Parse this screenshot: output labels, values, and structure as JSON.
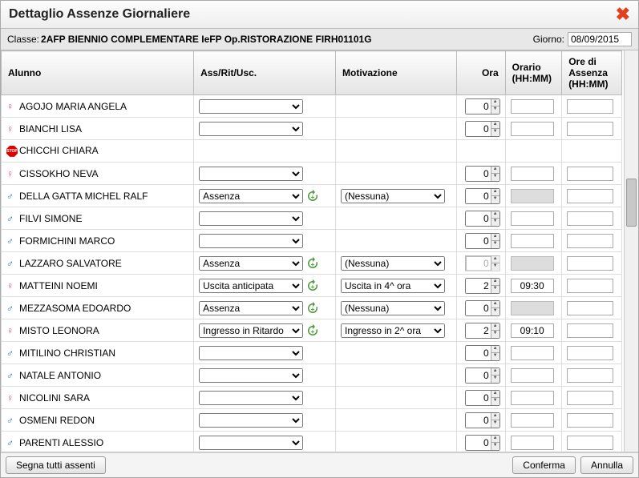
{
  "title": "Dettaglio Assenze Giornaliere",
  "class_label": "Classe:",
  "class_value": "2AFP BIENNIO COMPLEMENTARE IeFP Op.RISTORAZIONE FIRH01101G",
  "day_label": "Giorno:",
  "day_value": "08/09/2015",
  "columns": {
    "alunno": "Alunno",
    "ass": "Ass/Rit/Usc.",
    "motiv": "Motivazione",
    "ora": "Ora",
    "orario": "Orario (HH:MM)",
    "ore": "Ore di Assenza (HH:MM)"
  },
  "type_options": [
    "",
    "Assenza",
    "Ingresso in Ritardo",
    "Uscita anticipata"
  ],
  "motiv_options": [
    "",
    "(Nessuna)",
    "Ingresso in 2^ ora",
    "Uscita in 4^ ora"
  ],
  "rows": [
    {
      "gender": "F",
      "name": "AGOJO MARIA ANGELA",
      "type": "",
      "motiv": null,
      "ora": "0",
      "ora_disabled": false,
      "orario": "",
      "orario_disabled": false
    },
    {
      "gender": "F",
      "name": "BIANCHI LISA",
      "type": "",
      "motiv": null,
      "ora": "0",
      "ora_disabled": false,
      "orario": "",
      "orario_disabled": false
    },
    {
      "gender": "STOP",
      "name": "CHICCHI CHIARA",
      "type": null,
      "motiv": null,
      "ora": null,
      "orario": null
    },
    {
      "gender": "F",
      "name": "CISSOKHO NEVA",
      "type": "",
      "motiv": null,
      "ora": "0",
      "ora_disabled": false,
      "orario": "",
      "orario_disabled": false
    },
    {
      "gender": "M",
      "name": "DELLA GATTA MICHEL RALF",
      "type": "Assenza",
      "refresh": true,
      "motiv": "(Nessuna)",
      "ora": "0",
      "ora_disabled": false,
      "orario": "",
      "orario_disabled": true
    },
    {
      "gender": "M",
      "name": "FILVI SIMONE",
      "type": "",
      "motiv": null,
      "ora": "0",
      "ora_disabled": false,
      "orario": "",
      "orario_disabled": false
    },
    {
      "gender": "M",
      "name": "FORMICHINI MARCO",
      "type": "",
      "motiv": null,
      "ora": "0",
      "ora_disabled": false,
      "orario": "",
      "orario_disabled": false
    },
    {
      "gender": "M",
      "name": "LAZZARO SALVATORE",
      "type": "Assenza",
      "refresh": true,
      "motiv": "(Nessuna)",
      "ora": "0",
      "ora_disabled": true,
      "orario": "",
      "orario_disabled": true
    },
    {
      "gender": "F",
      "name": "MATTEINI NOEMI",
      "type": "Uscita anticipata",
      "refresh": true,
      "motiv": "Uscita in 4^ ora",
      "ora": "2",
      "ora_disabled": false,
      "orario": "09:30",
      "orario_disabled": false
    },
    {
      "gender": "M",
      "name": "MEZZASOMA EDOARDO",
      "type": "Assenza",
      "refresh": true,
      "motiv": "(Nessuna)",
      "ora": "0",
      "ora_disabled": false,
      "orario": "",
      "orario_disabled": true
    },
    {
      "gender": "F",
      "name": "MISTO LEONORA",
      "type": "Ingresso in Ritardo",
      "refresh": true,
      "motiv": "Ingresso in 2^ ora",
      "ora": "2",
      "ora_disabled": false,
      "orario": "09:10",
      "orario_disabled": false
    },
    {
      "gender": "M",
      "name": "MITILINO CHRISTIAN",
      "type": "",
      "motiv": null,
      "ora": "0",
      "ora_disabled": false,
      "orario": "",
      "orario_disabled": false
    },
    {
      "gender": "M",
      "name": "NATALE ANTONIO",
      "type": "",
      "motiv": null,
      "ora": "0",
      "ora_disabled": false,
      "orario": "",
      "orario_disabled": false
    },
    {
      "gender": "F",
      "name": "NICOLINI SARA",
      "type": "",
      "motiv": null,
      "ora": "0",
      "ora_disabled": false,
      "orario": "",
      "orario_disabled": false
    },
    {
      "gender": "M",
      "name": "OSMENI REDON",
      "type": "",
      "motiv": null,
      "ora": "0",
      "ora_disabled": false,
      "orario": "",
      "orario_disabled": false
    },
    {
      "gender": "M",
      "name": "PARENTI ALESSIO",
      "type": "",
      "motiv": null,
      "ora": "0",
      "ora_disabled": false,
      "orario": "",
      "orario_disabled": false
    }
  ],
  "footer": {
    "mark_all": "Segna tutti assenti",
    "confirm": "Conferma",
    "cancel": "Annulla"
  }
}
